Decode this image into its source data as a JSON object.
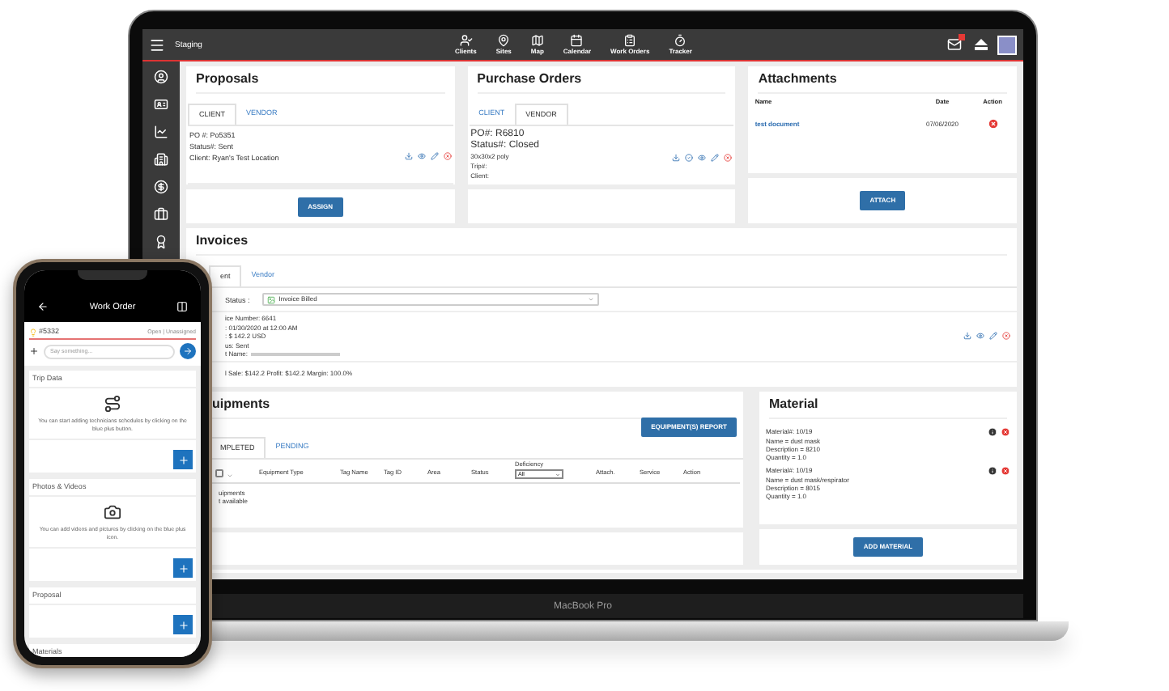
{
  "laptop": {
    "label": "MacBook Pro",
    "topbar": {
      "title": "Staging",
      "nav": [
        "Clients",
        "Sites",
        "Map",
        "Calendar",
        "Work Orders",
        "Tracker"
      ]
    },
    "proposals": {
      "title": "Proposals",
      "tabs": [
        {
          "label": "CLIENT",
          "selected": true
        },
        {
          "label": "VENDOR",
          "selected": false
        }
      ],
      "lines": [
        "PO #: Po5351",
        "Status#: Sent",
        "Client:   Ryan's Test Location"
      ],
      "button": "ASSIGN"
    },
    "purchase_orders": {
      "title": "Purchase Orders",
      "tabs": [
        {
          "label": "CLIENT",
          "selected": false
        },
        {
          "label": "VENDOR",
          "selected": true
        }
      ],
      "po": "PO#:   R6810",
      "status": "Status#:   Closed",
      "lines": [
        "30x30x2 poly",
        "Trip#:",
        "Client:"
      ]
    },
    "attachments": {
      "title": "Attachments",
      "columns": [
        "Name",
        "Date",
        "Action"
      ],
      "rows": [
        {
          "name": "test document",
          "date": "07/06/2020"
        }
      ],
      "button": "ATTACH"
    },
    "invoices": {
      "title": "Invoices",
      "tabs": [
        {
          "label": "ent",
          "selected": true
        },
        {
          "label": "Vendor",
          "selected": false
        }
      ],
      "status_label": "Status :",
      "status_value": "Invoice Billed",
      "lines": [
        "ice Number: 6641",
        ": 01/30/2020 at 12:00 AM",
        ": $ 142.2 USD",
        "us: Sent",
        "t Name:"
      ],
      "totals": "l Sale: $142.2 Profit: $142.2 Margin: 100.0%"
    },
    "equipments": {
      "title": "uipments",
      "report_button": "EQUIPMENT(S) REPORT",
      "tabs": [
        {
          "label": "MPLETED",
          "selected": true
        },
        {
          "label": "PENDING",
          "selected": false
        }
      ],
      "columns": [
        "Equipment Type",
        "Tag Name",
        "Tag ID",
        "Area",
        "Status",
        "Deficiency",
        "Attach.",
        "Service",
        "Action"
      ],
      "deficiency_filter": "All",
      "select_all": {
        "checked": false
      },
      "empty": [
        "uipments",
        "t available"
      ]
    },
    "material": {
      "title": "Material",
      "items": [
        {
          "number": "Material#: 10/19",
          "lines": [
            "Name = dust mask",
            "Description = 8210",
            "Quantity = 1.0"
          ]
        },
        {
          "number": "Material#: 10/19",
          "lines": [
            "Name = dust mask/respirator",
            "Description = 8015",
            "Quantity = 1.0"
          ]
        }
      ],
      "button": "ADD MATERIAL"
    }
  },
  "phone": {
    "title": "Work Order",
    "order": "#5332",
    "status": "Open | Unassigned",
    "placeholder": "Say something...",
    "sections": [
      {
        "kind": "trip",
        "title": "Trip Data",
        "text": "You can start adding technicians schedules by clicking on the blue plus button."
      },
      {
        "kind": "photos",
        "title": "Photos & Videos",
        "text": "You can add videos and pictures by clicking on the blue plus icon."
      },
      {
        "kind": "plain",
        "title": "Proposal"
      },
      {
        "kind": "cut",
        "title": "Materials"
      }
    ]
  }
}
